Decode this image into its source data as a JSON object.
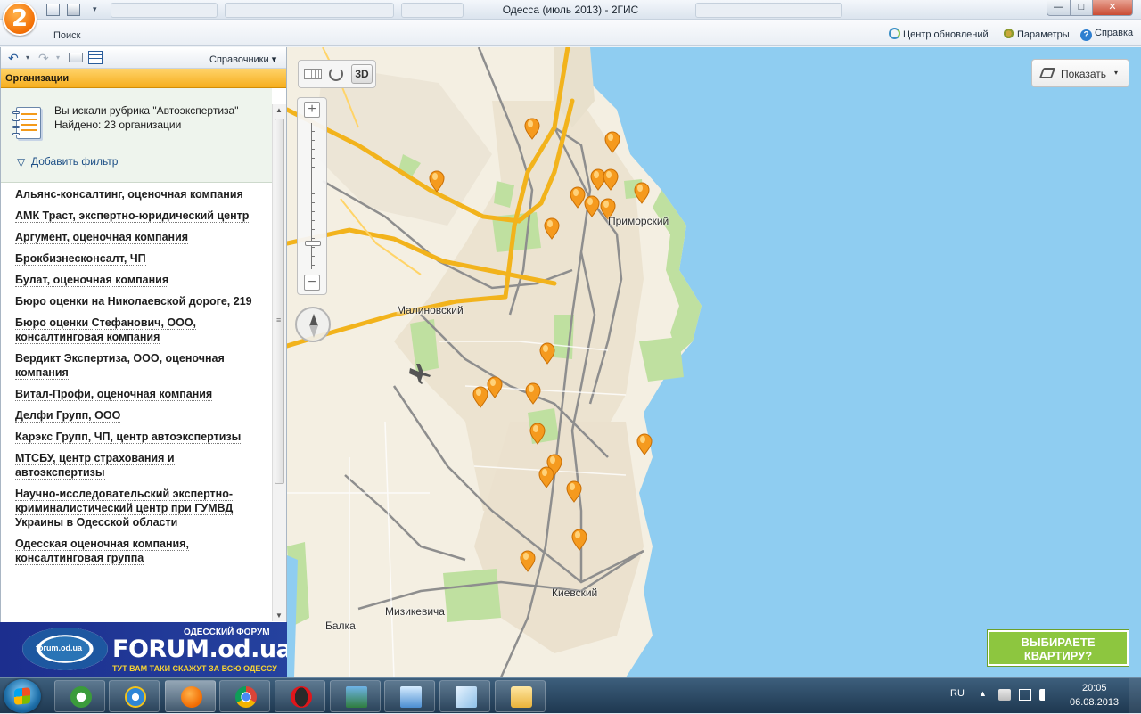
{
  "window": {
    "title": "Одесса (июль 2013) - 2ГИС",
    "logo_text": "2",
    "min_glyph": "—",
    "max_glyph": "□",
    "close_glyph": "✕"
  },
  "toolbar": {
    "search_tab": "Поиск",
    "updates": "Центр обновлений",
    "params": "Параметры",
    "help": "Справка",
    "help_glyph": "?"
  },
  "panel": {
    "back_glyph": "↶",
    "forward_glyph": "↷",
    "dropdown_glyph": "▾",
    "references_menu": "Справочники ▾",
    "section_title": "Организации",
    "search_text": "Вы искали рубрика \"Автоэкспертиза\"",
    "found_text": "Найдено: 23 организации",
    "add_filter": "Добавить фильтр",
    "filter_glyph": "▽"
  },
  "organizations": [
    "Альянс-консалтинг, оценочная компания",
    "АМК Траст, экспертно-юридический центр",
    "Аргумент, оценочная компания",
    "Брокбизнесконсалт, ЧП",
    "Булат, оценочная компания",
    "Бюро оценки на Николаевской дороге, 219",
    "Бюро оценки Стефанович, ООО, консалтинговая компания",
    "Вердикт Экспертиза, ООО, оценочная компания",
    "Витал-Профи, оценочная компания",
    "Делфи Групп, ООО",
    "Карэкс Групп, ЧП, центр автоэкспертизы",
    "МТСБУ, центр страхования и автоэкспертизы",
    "Научно-исследовательский экспертно-криминалистический центр при ГУМВД Украины в Одесской области",
    "Одесская оценочная компания, консалтинговая группа"
  ],
  "scroll": {
    "up": "▲",
    "down": "▼"
  },
  "banner": {
    "top_text": "ОДЕССКИЙ ФОРУМ",
    "domain": "FORUM.od.ua",
    "slogan": "ТУТ ВАМ ТАКИ СКАЖУТ ЗА ВСЮ ОДЕССУ",
    "seal_text": "forum.od.ua"
  },
  "map": {
    "btn_3d": "3D",
    "zoom_in": "+",
    "zoom_out": "−",
    "show_layers": "Показать",
    "show_caret": "▾",
    "labels": {
      "malinovsky": "Малиновский",
      "primorsky": "Приморский",
      "kievsky": "Киевский",
      "mizikevicha": "Мизикевича",
      "balka": "Балка"
    },
    "ad_line1": "ВЫБИРАЕТЕ",
    "ad_line2": "КВАРТИРУ?",
    "colors": {
      "sea": "#8fcdf1",
      "land": "#f4efe2",
      "park": "#bfe0a0",
      "road": "#f2b31c",
      "marker": "#f59a1e"
    }
  },
  "taskbar": {
    "lang": "RU",
    "tray_up": "▲",
    "time": "20:05",
    "date": "06.08.2013"
  }
}
